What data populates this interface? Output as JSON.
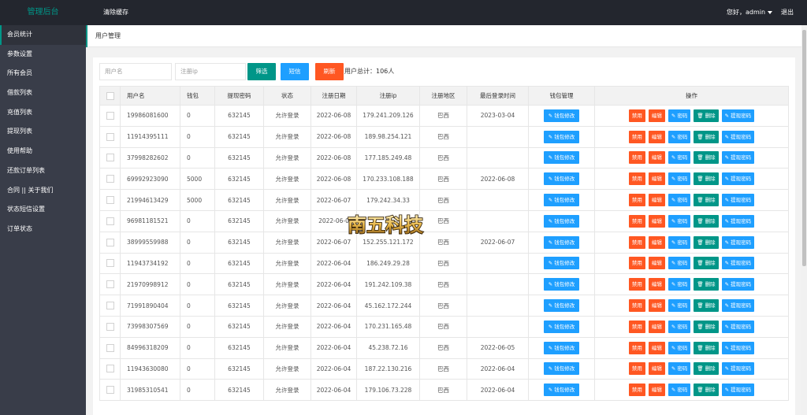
{
  "header": {
    "brand": "管理后台",
    "clear_cache": "清除缓存",
    "greeting": "您好，admin",
    "logout": "退出"
  },
  "sidebar": {
    "items": [
      {
        "label": "会员统计"
      },
      {
        "label": "参数设置"
      },
      {
        "label": "所有会员"
      },
      {
        "label": "借款列表"
      },
      {
        "label": "充值列表"
      },
      {
        "label": "提现列表"
      },
      {
        "label": "使用帮助"
      },
      {
        "label": "还款订单列表"
      },
      {
        "label": "合同 || 关于我们"
      },
      {
        "label": "状态短信设置"
      },
      {
        "label": "订单状态"
      }
    ]
  },
  "tab": {
    "label": "用户管理"
  },
  "toolbar": {
    "username_placeholder": "用户名",
    "ip_placeholder": "注册ip",
    "filter_label": "筛选",
    "sms_label": "短信",
    "refresh_label": "刷新",
    "total_text": "用户总计：106人"
  },
  "table": {
    "columns": [
      "用户名",
      "钱包",
      "提现密码",
      "状态",
      "注册日期",
      "注册ip",
      "注册地区",
      "最后登录时间",
      "钱包管理",
      "操作"
    ],
    "wallet_edit_label": "钱包修改",
    "actions": {
      "disable": "禁用",
      "edit": "编辑",
      "password": "密码",
      "delete": "删除",
      "withdraw_password": "提现密码"
    },
    "rows": [
      {
        "username": "19986081600",
        "wallet": "0",
        "pwd": "632145",
        "status": "允许登录",
        "reg_date": "2022-06-08",
        "ip": "179.241.209.126",
        "region": "巴西",
        "last_login": "2023-03-04"
      },
      {
        "username": "11914395111",
        "wallet": "0",
        "pwd": "632145",
        "status": "允许登录",
        "reg_date": "2022-06-08",
        "ip": "189.98.254.121",
        "region": "巴西",
        "last_login": ""
      },
      {
        "username": "37998282602",
        "wallet": "0",
        "pwd": "632145",
        "status": "允许登录",
        "reg_date": "2022-06-08",
        "ip": "177.185.249.48",
        "region": "巴西",
        "last_login": ""
      },
      {
        "username": "69992923090",
        "wallet": "5000",
        "pwd": "632145",
        "status": "允许登录",
        "reg_date": "2022-06-08",
        "ip": "170.233.108.188",
        "region": "巴西",
        "last_login": "2022-06-08"
      },
      {
        "username": "21994613429",
        "wallet": "5000",
        "pwd": "632145",
        "status": "允许登录",
        "reg_date": "2022-06-07",
        "ip": "179.242.34.33",
        "region": "巴西",
        "last_login": ""
      },
      {
        "username": "96981181521",
        "wallet": "0",
        "pwd": "632145",
        "status": "允许登录",
        "reg_date": "2022-06-0",
        "ip": "",
        "region": "巴西",
        "last_login": ""
      },
      {
        "username": "38999559988",
        "wallet": "0",
        "pwd": "632145",
        "status": "允许登录",
        "reg_date": "2022-06-07",
        "ip": "152.255.121.172",
        "region": "巴西",
        "last_login": "2022-06-07"
      },
      {
        "username": "11943734192",
        "wallet": "0",
        "pwd": "632145",
        "status": "允许登录",
        "reg_date": "2022-06-04",
        "ip": "186.249.29.28",
        "region": "巴西",
        "last_login": ""
      },
      {
        "username": "21970998912",
        "wallet": "0",
        "pwd": "632145",
        "status": "允许登录",
        "reg_date": "2022-06-04",
        "ip": "191.242.109.38",
        "region": "巴西",
        "last_login": ""
      },
      {
        "username": "71991890404",
        "wallet": "0",
        "pwd": "632145",
        "status": "允许登录",
        "reg_date": "2022-06-04",
        "ip": "45.162.172.244",
        "region": "巴西",
        "last_login": ""
      },
      {
        "username": "73998307569",
        "wallet": "0",
        "pwd": "632145",
        "status": "允许登录",
        "reg_date": "2022-06-04",
        "ip": "170.231.165.48",
        "region": "巴西",
        "last_login": ""
      },
      {
        "username": "84996318209",
        "wallet": "0",
        "pwd": "632145",
        "status": "允许登录",
        "reg_date": "2022-06-04",
        "ip": "45.238.72.16",
        "region": "巴西",
        "last_login": "2022-06-05"
      },
      {
        "username": "11943630080",
        "wallet": "0",
        "pwd": "632145",
        "status": "允许登录",
        "reg_date": "2022-06-04",
        "ip": "187.22.130.216",
        "region": "巴西",
        "last_login": "2022-06-04"
      },
      {
        "username": "31985310541",
        "wallet": "0",
        "pwd": "632145",
        "status": "允许登录",
        "reg_date": "2022-06-04",
        "ip": "179.106.73.228",
        "region": "巴西",
        "last_login": "2022-06-04"
      }
    ]
  },
  "watermark": {
    "text": "南五科技"
  },
  "colors": {
    "header_bg": "#23262e",
    "sidebar_bg": "#393d49",
    "accent_teal": "#009688",
    "blue": "#1e9fff",
    "red": "#ff5722"
  }
}
